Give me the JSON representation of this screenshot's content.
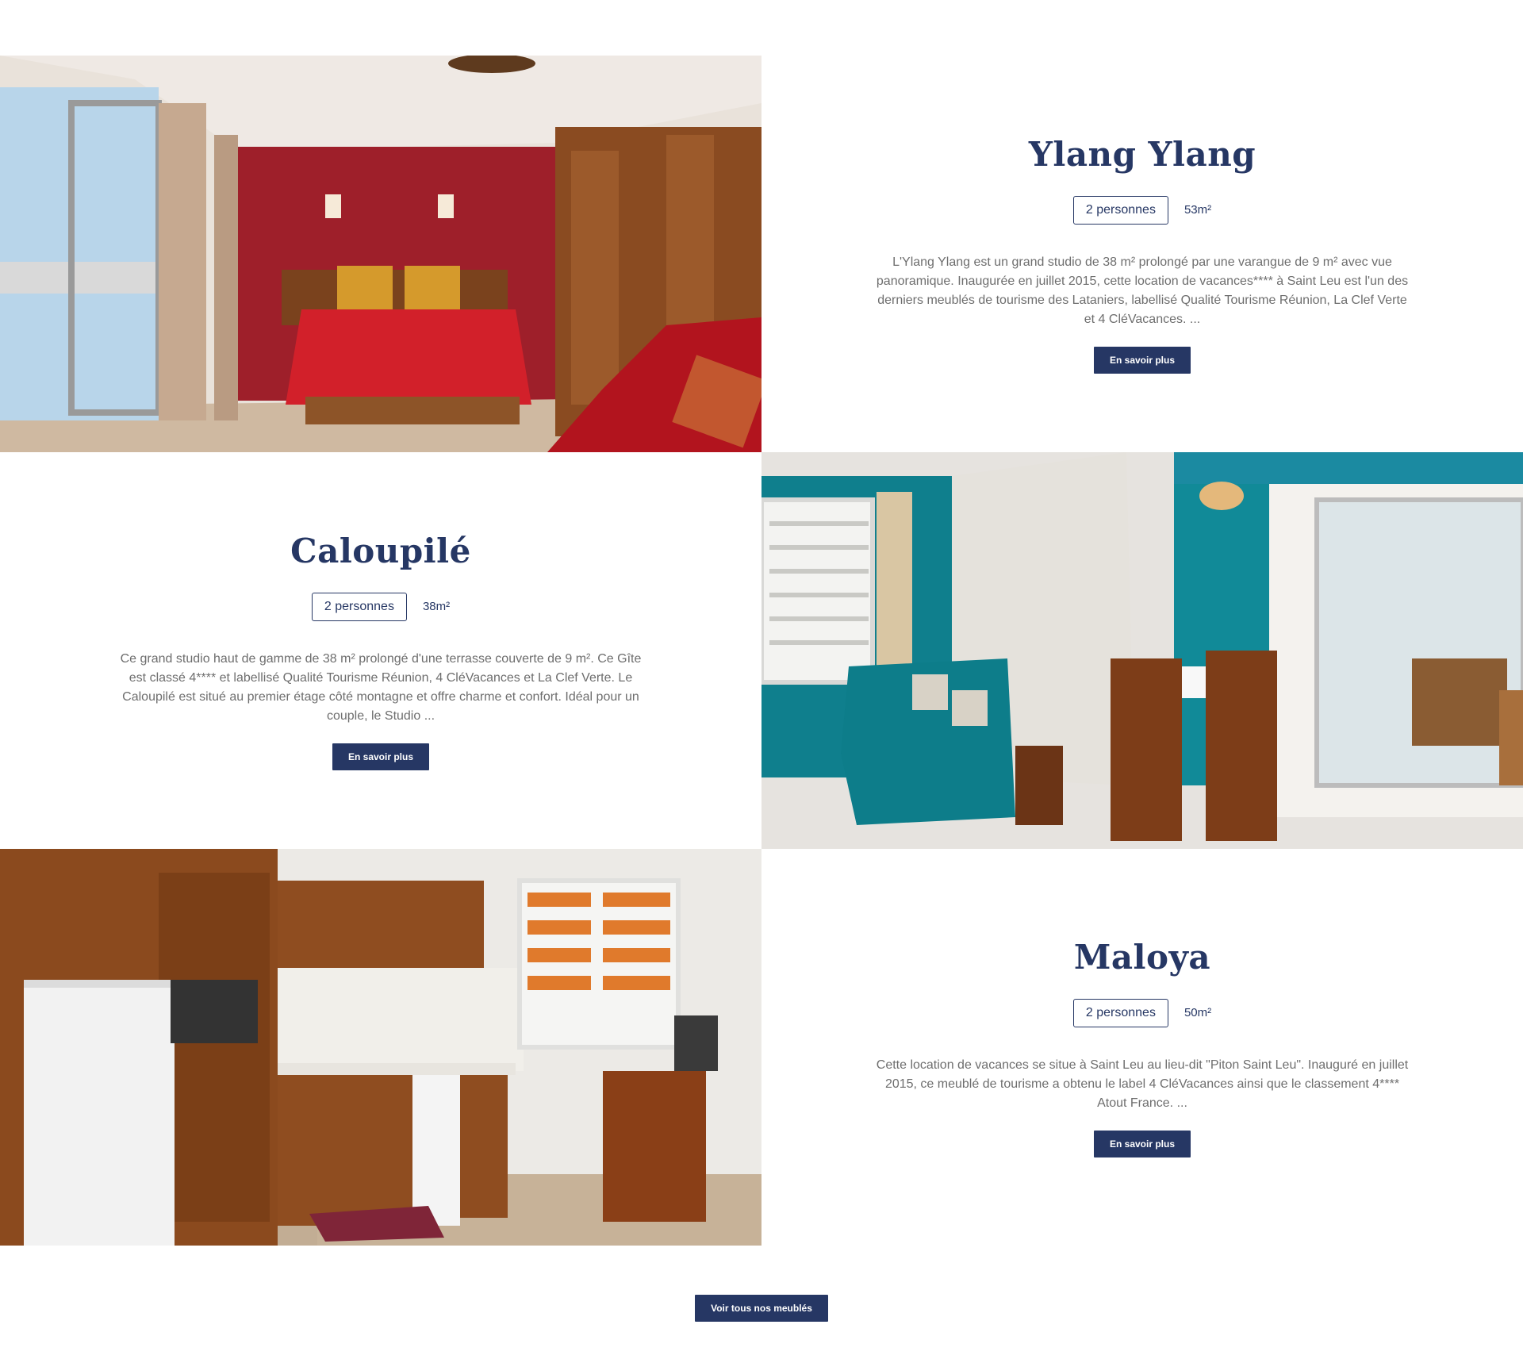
{
  "listings": [
    {
      "title": "Ylang Ylang",
      "capacity": "2 personnes",
      "area": "53m²",
      "description": "L'Ylang Ylang est un grand studio de 38 m² prolongé par une varangue de 9 m² avec vue panoramique. Inaugurée en juillet 2015, cette location de vacances**** à Saint Leu est l'un des derniers meublés de tourisme des Lataniers, labellisé Qualité Tourisme Réunion, La Clef Verte et 4 CléVacances. ...",
      "button_label": "En savoir plus"
    },
    {
      "title": "Caloupilé",
      "capacity": "2 personnes",
      "area": "38m²",
      "description": "Ce grand studio haut de gamme de 38 m² prolongé d'une terrasse couverte de 9 m². Ce Gîte est classé 4**** et labellisé Qualité Tourisme Réunion, 4 CléVacances et La Clef Verte. Le Caloupilé est situé au premier étage côté montagne et offre charme et confort. Idéal pour un couple, le Studio ...",
      "button_label": "En savoir plus"
    },
    {
      "title": "Maloya",
      "capacity": "2 personnes",
      "area": "50m²",
      "description": "Cette location de vacances se situe à Saint Leu au lieu-dit \"Piton Saint Leu\". Inauguré en juillet 2015, ce meublé de tourisme a obtenu le label 4 CléVacances ainsi que le classement 4**** Atout France. ...",
      "button_label": "En savoir plus"
    }
  ],
  "footer": {
    "all_button_label": "Voir tous nos meublés"
  },
  "colors": {
    "accent": "#263764",
    "text": "#6e6e6e"
  }
}
